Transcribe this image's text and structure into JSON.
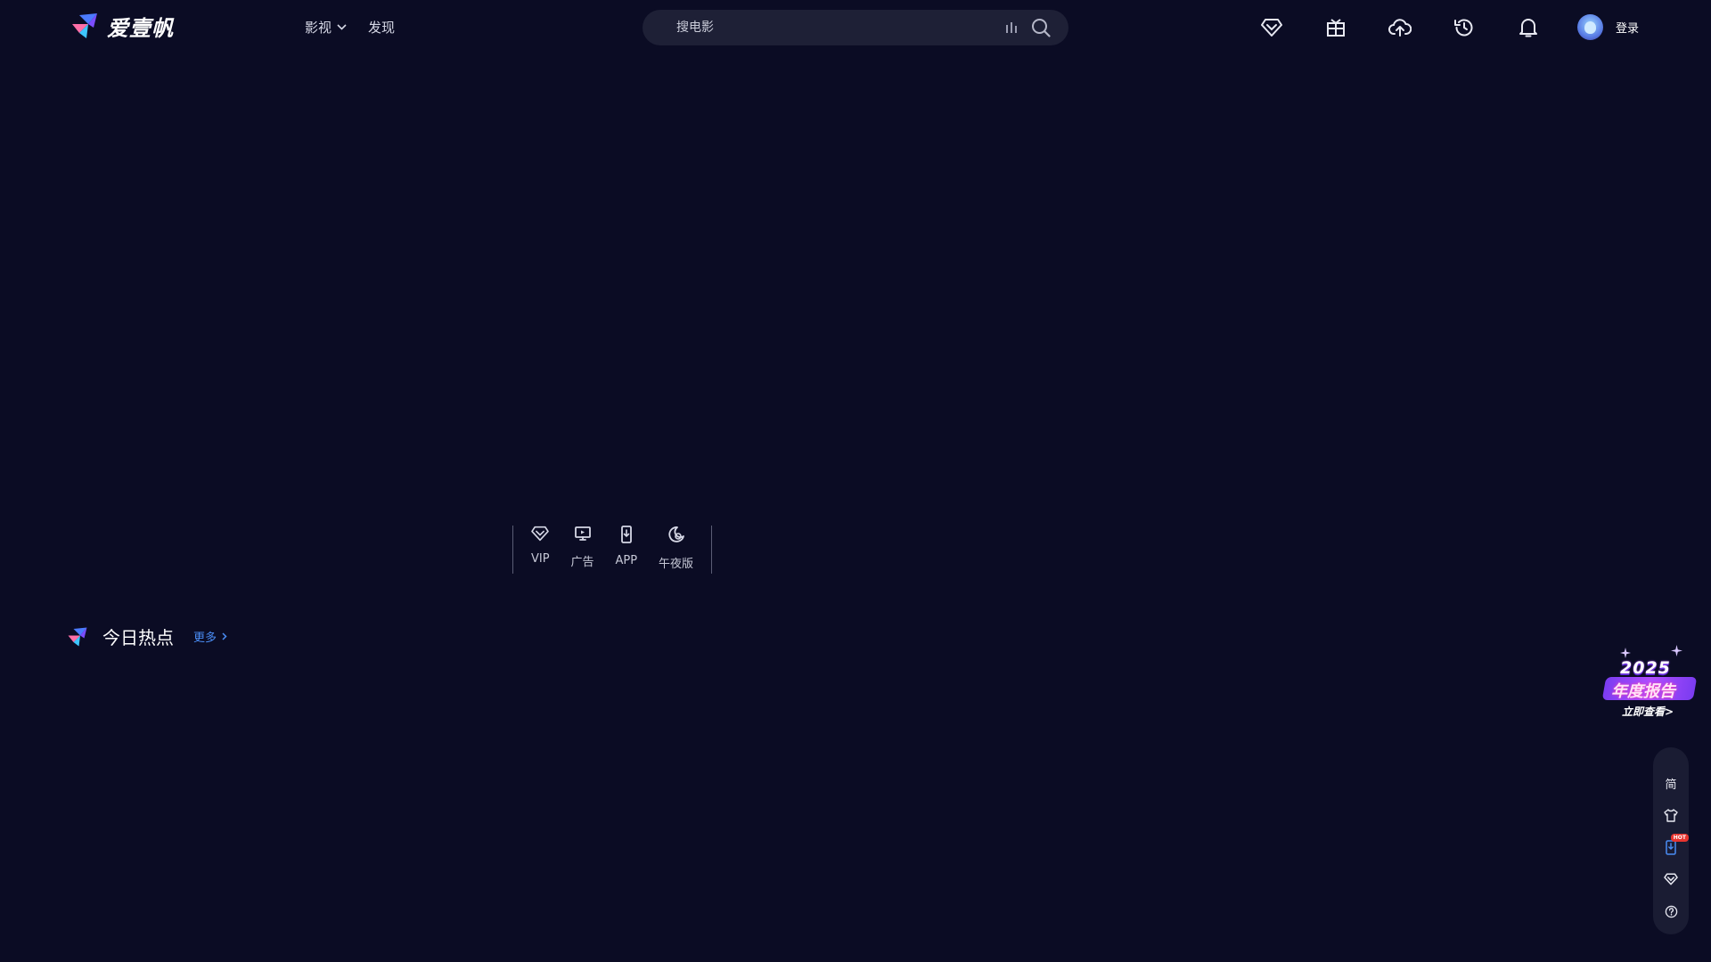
{
  "header": {
    "logo_text": "爱壹帆",
    "nav": [
      {
        "label": "影视",
        "has_dropdown": true
      },
      {
        "label": "发现",
        "has_dropdown": false
      }
    ],
    "search": {
      "placeholder": "搜电影",
      "value": ""
    },
    "icons": [
      "vip-diamond-icon",
      "gift-icon",
      "upload-cloud-icon",
      "history-icon",
      "bell-icon"
    ],
    "login_label": "登录"
  },
  "quick_links": [
    {
      "label": "VIP",
      "icon": "vip-diamond-icon"
    },
    {
      "label": "广告",
      "icon": "monitor-icon"
    },
    {
      "label": "APP",
      "icon": "phone-download-icon"
    },
    {
      "label": "午夜版",
      "icon": "midnight-icon"
    }
  ],
  "hot_section": {
    "title": "今日热点",
    "more_label": "更多"
  },
  "report_badge": {
    "year": "2025",
    "title": "年度报告",
    "cta": "立即查看>"
  },
  "dock": {
    "simplified_label": "简",
    "hot_badge": "HOT",
    "items": [
      "simplified-chinese",
      "skin-icon",
      "app-download-icon",
      "vip-icon",
      "help-icon"
    ]
  },
  "colors": {
    "background": "#0b0c24",
    "search_bg": "#1e2036",
    "accent_blue": "#4a8df5",
    "hot_red": "#e8342f"
  }
}
